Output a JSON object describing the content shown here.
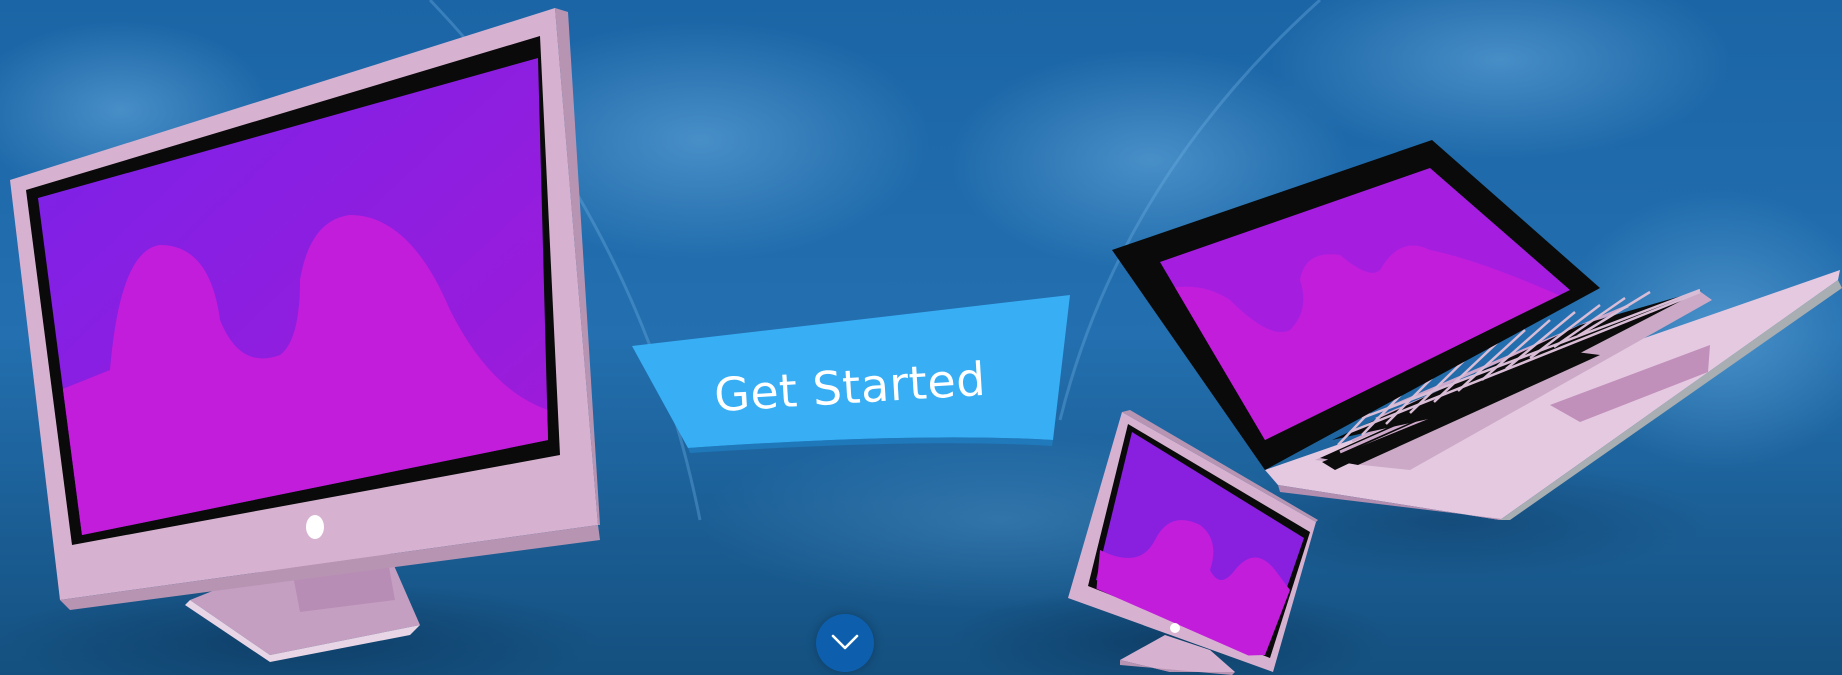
{
  "hero": {
    "cta_label": "Get Started",
    "scroll_icon": "chevron-down-icon"
  },
  "colors": {
    "background": "#1d6aa8",
    "cta": "#38aef5",
    "screen": "#c21ddb",
    "device_body": "#d6b2d0",
    "scroll_button": "#0d5fae"
  }
}
